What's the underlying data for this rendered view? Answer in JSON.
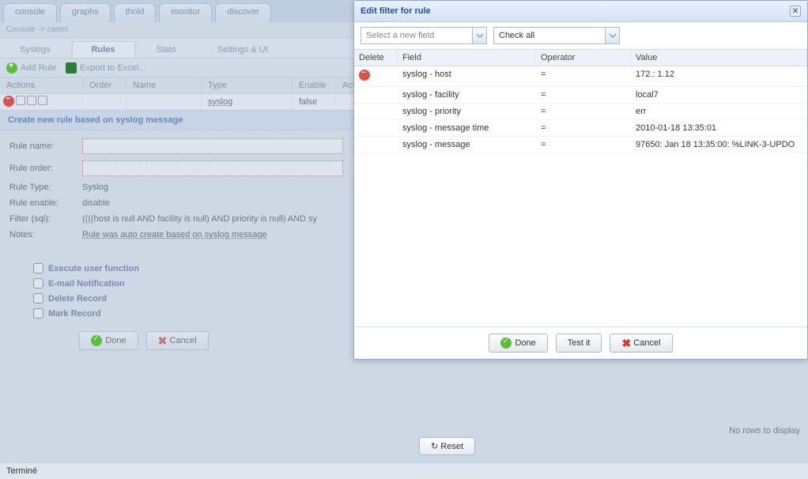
{
  "top_tabs": [
    "console",
    "graphs",
    "thold",
    "monitor",
    "discover"
  ],
  "breadcrumb": {
    "root": "Console",
    "sep": "->",
    "leaf": "camm"
  },
  "sub_tabs": {
    "items": [
      "Syslogs",
      "Rules",
      "Stats",
      "Settings & Ut"
    ],
    "active": 1
  },
  "toolbar": {
    "add": "Add Rule",
    "export": "Export to Excel..."
  },
  "grid_headers": {
    "actions": "Actions",
    "order": "Order",
    "name": "Name",
    "type": "Type",
    "enable": "Enable",
    "actions2": "Actions"
  },
  "grid_row": {
    "type": "syslog",
    "enable": "false"
  },
  "section_title": "Create new rule based on syslog message",
  "form": {
    "rule_name_label": "Rule name:",
    "rule_order_label": "Rule order:",
    "rule_type_label": "Rule Type:",
    "rule_type_value": "Syslog",
    "rule_enable_label": "Rule enable:",
    "rule_enable_value": "disable",
    "filter_label": "Filter (sql):",
    "filter_value": "((((host is null AND facility is null) AND priority is null) AND sy",
    "notes_label": "Notes:",
    "notes_value": "Rule was auto create based on syslog message"
  },
  "checks": {
    "exec": "Execute user function",
    "mail": "E-mail Notification",
    "del": "Delete Record",
    "mark": "Mark Record"
  },
  "buttons": {
    "done": "Done",
    "cancel": "Cancel",
    "testit": "Test it",
    "reset": "Reset"
  },
  "no_rows": "No rows to display",
  "status": "Terminé",
  "modal": {
    "title": "Edit filter for rule",
    "combo1": "Select a new field",
    "combo2": "Check all",
    "head": {
      "delete": "Delete",
      "field": "Field",
      "op": "Operator",
      "val": "Value"
    },
    "rows": [
      {
        "del": true,
        "field": "syslog - host",
        "op": "=",
        "val": "172.:      1.12"
      },
      {
        "del": false,
        "field": "syslog - facility",
        "op": "=",
        "val": "local7"
      },
      {
        "del": false,
        "field": "syslog - priority",
        "op": "=",
        "val": "err"
      },
      {
        "del": false,
        "field": "syslog - message time",
        "op": "=",
        "val": "2010-01-18 13:35:01"
      },
      {
        "del": false,
        "field": "syslog - message",
        "op": "=",
        "val": "97650: Jan 18 13:35:00: %LINK-3-UPDO"
      }
    ]
  }
}
